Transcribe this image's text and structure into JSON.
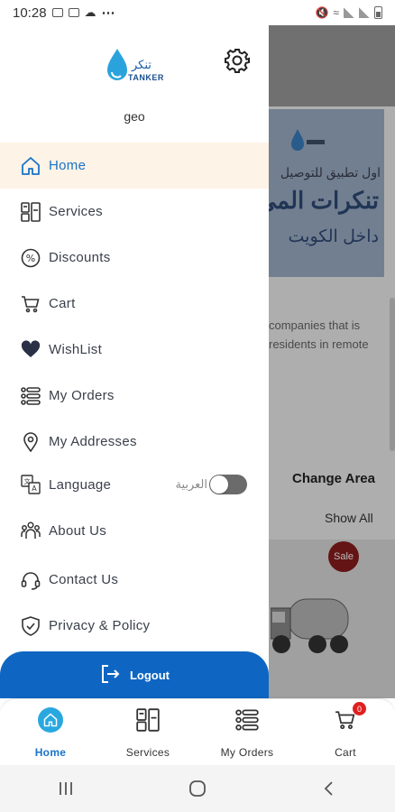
{
  "status_bar": {
    "time": "10:28",
    "more": "⋯"
  },
  "drawer": {
    "logo_text": "TANKER",
    "username": "geo",
    "menu": [
      {
        "label": "Home",
        "icon": "home-icon"
      },
      {
        "label": "Services",
        "icon": "services-icon"
      },
      {
        "label": "Discounts",
        "icon": "percent-icon"
      },
      {
        "label": "Cart",
        "icon": "cart-icon"
      },
      {
        "label": "WishList",
        "icon": "heart-icon"
      },
      {
        "label": "My Orders",
        "icon": "orders-icon"
      },
      {
        "label": "My Addresses",
        "icon": "location-pin-icon"
      },
      {
        "label": "Language",
        "icon": "translate-icon"
      },
      {
        "label": "About Us",
        "icon": "people-icon"
      },
      {
        "label": "Contact Us",
        "icon": "headset-icon"
      },
      {
        "label": "Privacy & Policy",
        "icon": "shield-icon"
      }
    ],
    "language_toggle_label": "العربية",
    "logout_label": "Logout"
  },
  "background": {
    "banner_line1": "اول تطبيق للتوصيل",
    "banner_line2": "تنكرات المي",
    "banner_line3": "داخل الكويت",
    "description_line1": "companies that is",
    "description_line2": "residents in remote",
    "change_area": "Change Area",
    "show_all": "Show All",
    "sale_badge": "Sale"
  },
  "bottom_nav": [
    {
      "label": "Home",
      "icon": "home-icon",
      "active": true
    },
    {
      "label": "Services",
      "icon": "services-icon"
    },
    {
      "label": "My Orders",
      "icon": "orders-icon"
    },
    {
      "label": "Cart",
      "icon": "cart-icon",
      "badge": "0"
    }
  ],
  "colors": {
    "accent": "#1a73c9",
    "logout": "#0f66c2",
    "active_bg": "#fdf3e6",
    "home_circle": "#29a8e0",
    "badge": "#e02020"
  }
}
